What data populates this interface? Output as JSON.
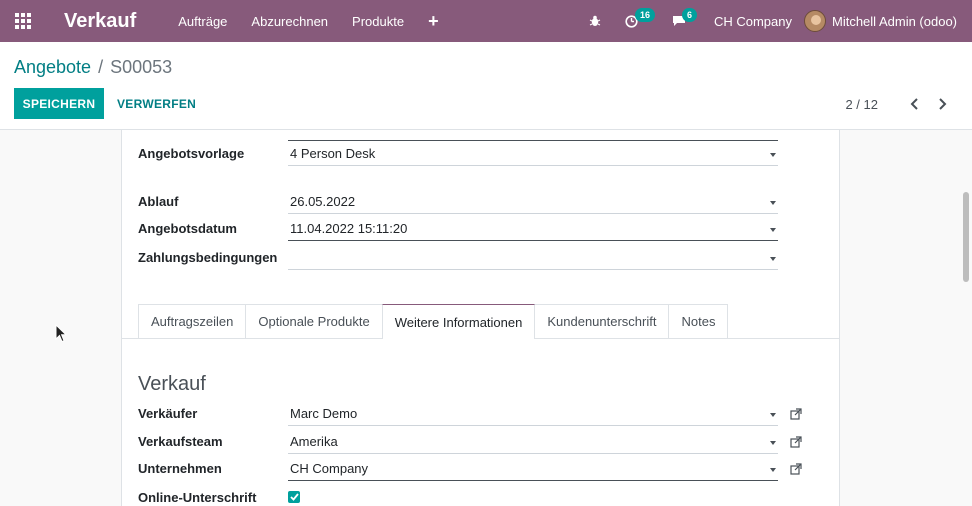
{
  "navbar": {
    "app_name": "Verkauf",
    "menu": [
      "Aufträge",
      "Abzurechnen",
      "Produkte"
    ],
    "plus": "+",
    "activity_count": "16",
    "messages_count": "6",
    "company": "CH Company",
    "user": "Mitchell Admin (odoo)",
    "icons": [
      "apps-grid-icon",
      "bug-icon",
      "clock-icon",
      "chat-icon",
      "avatar"
    ],
    "brand_color": "#875a7b"
  },
  "breadcrumb": {
    "parent": "Angebote",
    "separator": "/",
    "current": "S00053"
  },
  "buttons": {
    "save": "SPEICHERN",
    "discard": "VERWERFEN",
    "accent_color": "#00a09d"
  },
  "pager": {
    "value": "2 / 12"
  },
  "form": {
    "template_label": "Angebotsvorlage",
    "template_value": "4 Person Desk",
    "expiration_label": "Ablauf",
    "expiration_value": "26.05.2022",
    "quote_date_label": "Angebotsdatum",
    "quote_date_value": "11.04.2022 15:11:20",
    "payment_terms_label": "Zahlungsbedingungen",
    "payment_terms_value": ""
  },
  "tabs": [
    "Auftragszeilen",
    "Optionale Produkte",
    "Weitere Informationen",
    "Kundenunterschrift",
    "Notes"
  ],
  "active_tab": "Weitere Informationen",
  "sales_section": {
    "title": "Verkauf",
    "salesperson_label": "Verkäufer",
    "salesperson_value": "Marc Demo",
    "team_label": "Verkaufsteam",
    "team_value": "Amerika",
    "company_label": "Unternehmen",
    "company_value": "CH Company",
    "online_signature_label": "Online-Unterschrift",
    "online_signature_checked": true
  }
}
